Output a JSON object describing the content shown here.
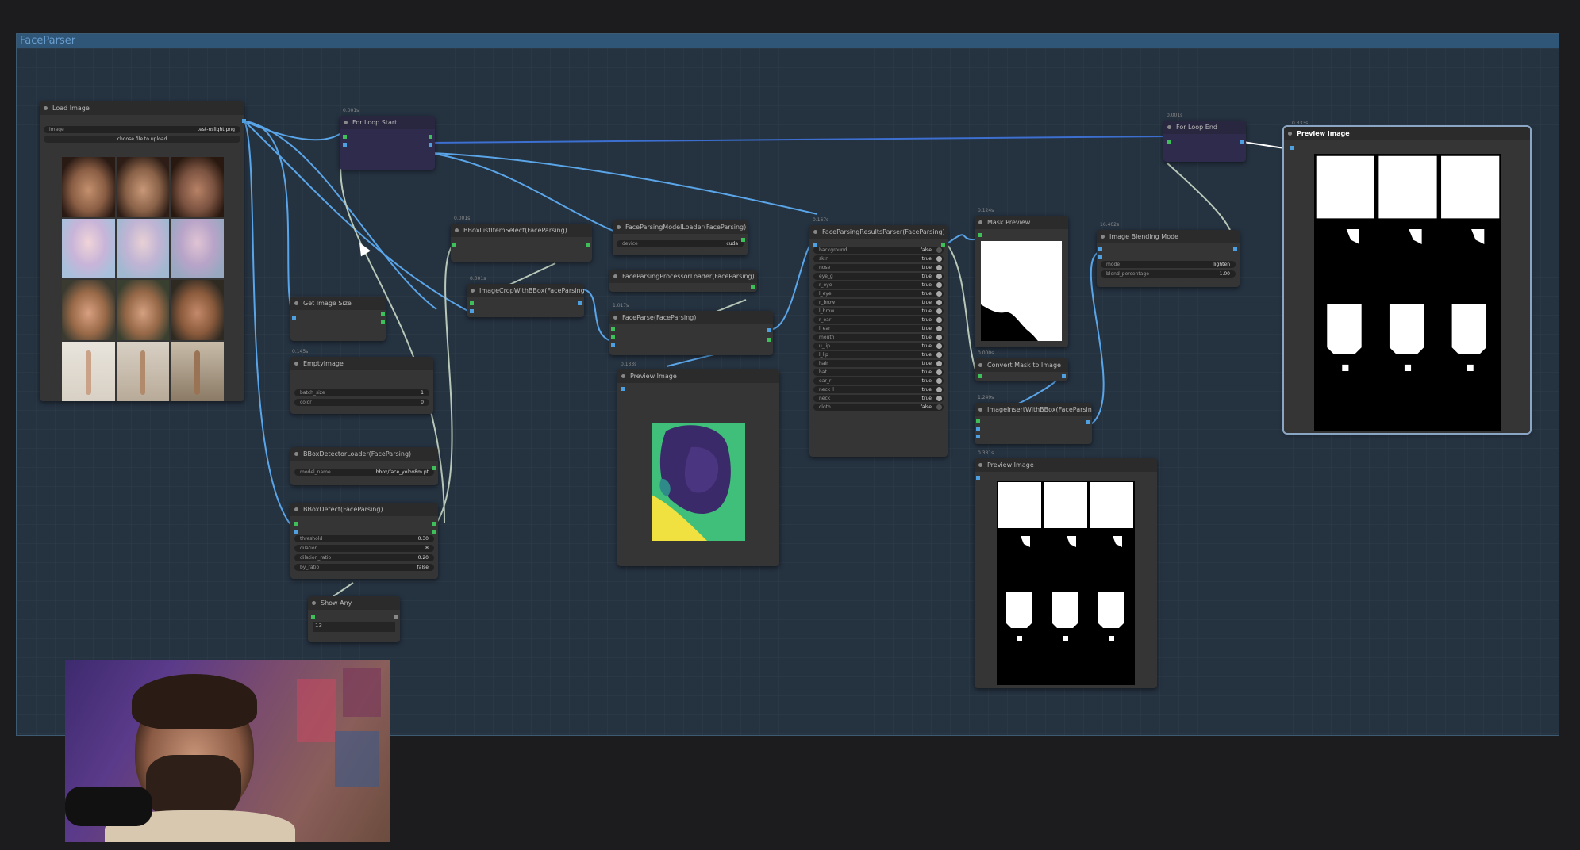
{
  "group": {
    "title": "FaceParser"
  },
  "nodes": {
    "load_image": {
      "title": "Load Image",
      "image_label": "image",
      "image_value": "test-nslight.png",
      "upload_label": "choose file to upload"
    },
    "for_loop_start": {
      "title": "For Loop Start",
      "time": "0.001s"
    },
    "for_loop_end": {
      "title": "For Loop End",
      "time": "0.001s"
    },
    "get_image_size": {
      "title": "Get Image Size"
    },
    "empty_image": {
      "title": "EmptyImage",
      "time": "0.145s",
      "batch_size_label": "batch_size",
      "batch_size_value": "1",
      "color_label": "color",
      "color_value": "0"
    },
    "bbox_detector_loader": {
      "title": "BBoxDetectorLoader(FaceParsing)",
      "model_label": "model_name",
      "model_value": "bbox/face_yolov8m.pt"
    },
    "bbox_detect": {
      "title": "BBoxDetect(FaceParsing)",
      "threshold_label": "threshold",
      "threshold_value": "0.30",
      "dilation_label": "dilation",
      "dilation_value": "8",
      "dilation_ratio_label": "dilation_ratio",
      "dilation_ratio_value": "0.20",
      "by_ratio_label": "by_ratio",
      "by_ratio_value": "false"
    },
    "show_any": {
      "title": "Show Any",
      "value": "13"
    },
    "bbox_list_item_select": {
      "title": "BBoxListItemSelect(FaceParsing)",
      "time": "0.001s"
    },
    "image_crop_with_bbox": {
      "title": "ImageCropWithBBox(FaceParsing)",
      "time": "0.001s"
    },
    "face_parsing_model_loader": {
      "title": "FaceParsingModelLoader(FaceParsing)",
      "device_label": "device",
      "device_value": "cuda"
    },
    "face_parsing_processor_loader": {
      "title": "FaceParsingProcessorLoader(FaceParsing)"
    },
    "face_parse": {
      "title": "FaceParse(FaceParsing)",
      "time": "1.017s"
    },
    "preview_image_1": {
      "title": "Preview Image",
      "time": "0.133s"
    },
    "face_parsing_results_parser": {
      "title": "FaceParsingResultsParser(FaceParsing)",
      "time": "0.167s",
      "params": [
        {
          "label": "background",
          "value": "false"
        },
        {
          "label": "skin",
          "value": "true"
        },
        {
          "label": "nose",
          "value": "true"
        },
        {
          "label": "eye_g",
          "value": "true"
        },
        {
          "label": "r_eye",
          "value": "true"
        },
        {
          "label": "l_eye",
          "value": "true"
        },
        {
          "label": "r_brow",
          "value": "true"
        },
        {
          "label": "l_brow",
          "value": "true"
        },
        {
          "label": "r_ear",
          "value": "true"
        },
        {
          "label": "l_ear",
          "value": "true"
        },
        {
          "label": "mouth",
          "value": "true"
        },
        {
          "label": "u_lip",
          "value": "true"
        },
        {
          "label": "l_lip",
          "value": "true"
        },
        {
          "label": "hair",
          "value": "true"
        },
        {
          "label": "hat",
          "value": "true"
        },
        {
          "label": "ear_r",
          "value": "true"
        },
        {
          "label": "neck_l",
          "value": "true"
        },
        {
          "label": "neck",
          "value": "true"
        },
        {
          "label": "cloth",
          "value": "false"
        }
      ]
    },
    "mask_preview": {
      "title": "Mask Preview",
      "time": "0.124s"
    },
    "convert_mask_to_image": {
      "title": "Convert Mask to Image",
      "time": "0.000s"
    },
    "image_insert_with_bbox": {
      "title": "ImageInsertWithBBox(FaceParsing)",
      "time": "1.249s"
    },
    "preview_image_2": {
      "title": "Preview Image",
      "time": "0.331s"
    },
    "image_blending_mode": {
      "title": "Image Blending Mode",
      "time": "16.402s",
      "mode_label": "mode",
      "mode_value": "lighten",
      "blend_label": "blend_percentage",
      "blend_value": "1.00"
    },
    "preview_image_3": {
      "title": "Preview Image",
      "time": "0.333s"
    }
  },
  "colors": {
    "background": "#1c1c1e",
    "group_fill": "#253240",
    "group_title": "#2f5677",
    "node": "#353535",
    "loop_node": "#2e2b4d",
    "link_blue": "#5aa5e8",
    "link_light": "#b8c8b8",
    "port_green": "#3fbf5a",
    "port_blue": "#4fa0e0"
  }
}
